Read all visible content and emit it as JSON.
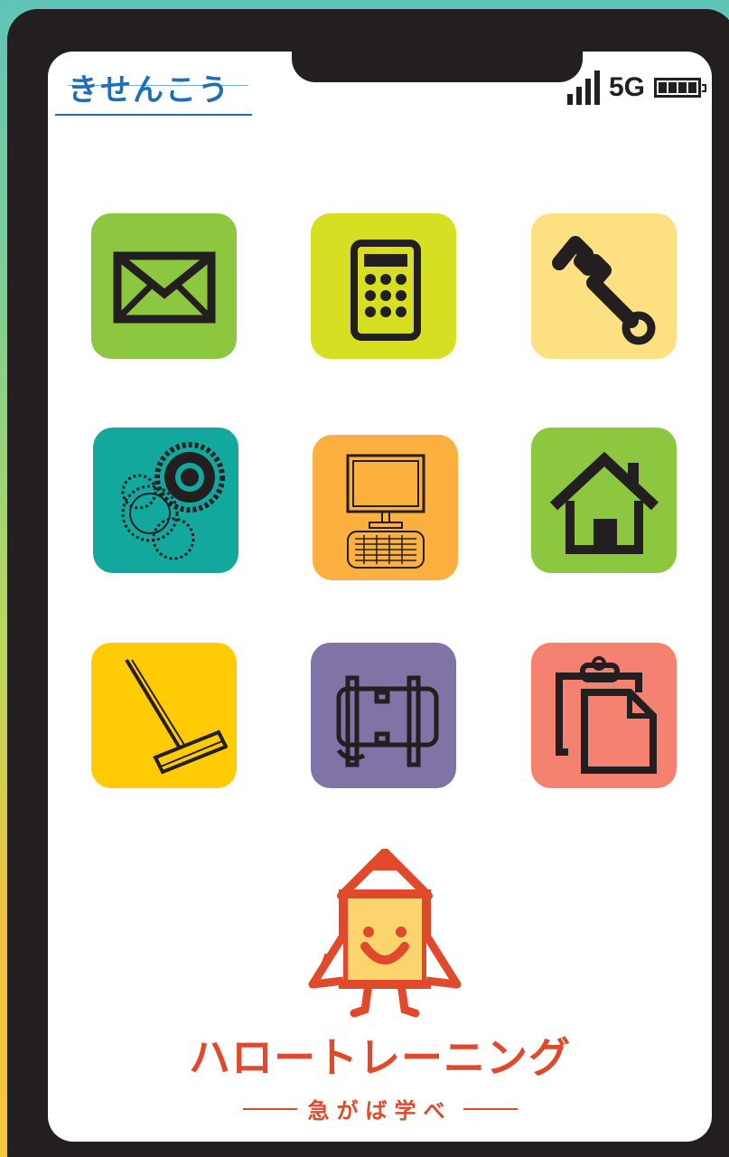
{
  "header": {
    "logo_text": "きせんこう",
    "network_label": "5G",
    "signal_icon": "signal-bars-icon",
    "battery_icon": "battery-full-icon"
  },
  "apps": [
    {
      "icon": "mail-icon",
      "color": "#8dc63f"
    },
    {
      "icon": "calculator-icon",
      "color": "#d7df23"
    },
    {
      "icon": "wrench-icon",
      "color": "#fde082"
    },
    {
      "icon": "gears-icon",
      "color": "#13a89e"
    },
    {
      "icon": "computer-icon",
      "color": "#fbb040"
    },
    {
      "icon": "home-icon",
      "color": "#8dc63f"
    },
    {
      "icon": "mop-icon",
      "color": "#ffcb05"
    },
    {
      "icon": "pipe-icon",
      "color": "#8073a5"
    },
    {
      "icon": "clipboard-icon",
      "color": "#f58170"
    }
  ],
  "branding": {
    "brand_name": "ハロートレーニング",
    "tagline": "急がば学べ",
    "accent_color": "#e04a2b"
  }
}
